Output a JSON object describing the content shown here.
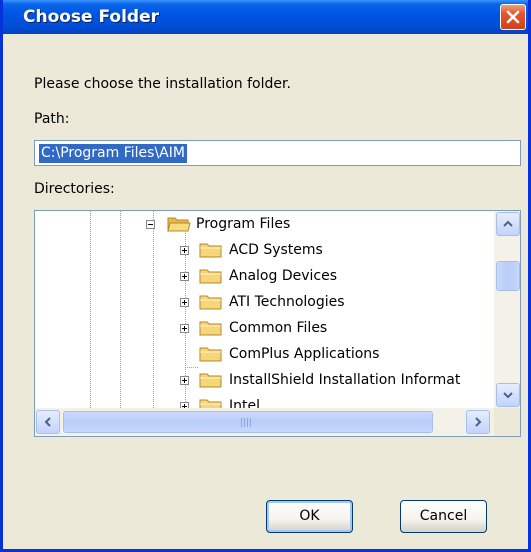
{
  "window": {
    "title": "Choose Folder"
  },
  "dialog": {
    "prompt": "Please choose the installation folder.",
    "path_label": "Path:",
    "path_value": "C:\\Program Files\\AIM",
    "directories_label": "Directories:"
  },
  "tree": {
    "parent": {
      "label": "Program Files",
      "expanded": true,
      "icon": "folder-open-icon"
    },
    "children": [
      {
        "label": "ACD Systems",
        "expandable": true,
        "icon": "folder-icon"
      },
      {
        "label": "Analog Devices",
        "expandable": true,
        "icon": "folder-icon"
      },
      {
        "label": "ATI Technologies",
        "expandable": true,
        "icon": "folder-icon"
      },
      {
        "label": "Common Files",
        "expandable": true,
        "icon": "folder-icon"
      },
      {
        "label": "ComPlus Applications",
        "expandable": false,
        "icon": "folder-icon"
      },
      {
        "label": "InstallShield Installation Informat",
        "expandable": true,
        "icon": "folder-icon"
      },
      {
        "label": "Intel",
        "expandable": true,
        "icon": "folder-icon"
      }
    ]
  },
  "buttons": {
    "ok": "OK",
    "cancel": "Cancel"
  },
  "colors": {
    "titlebar": "#0055E5",
    "window_bg": "#ECE9D8",
    "selection": "#316AC5",
    "folder": "#F5D77A"
  }
}
